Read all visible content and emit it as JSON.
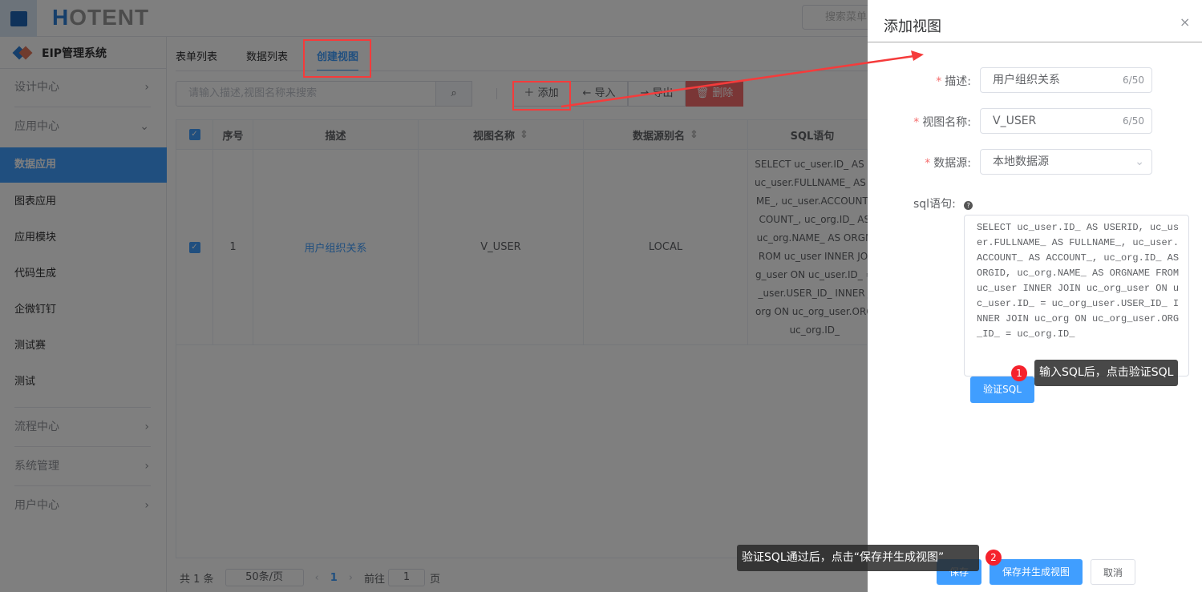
{
  "header": {
    "logo": "HOTENT",
    "search_placeholder": "搜索菜单"
  },
  "sidebar": {
    "brand": "EIP管理系统",
    "items": [
      {
        "label": "设计中心",
        "type": "group"
      },
      {
        "label": "应用中心",
        "type": "group"
      },
      {
        "label": "数据应用",
        "active": true
      },
      {
        "label": "图表应用"
      },
      {
        "label": "应用模块"
      },
      {
        "label": "代码生成"
      },
      {
        "label": "企微钉钉"
      },
      {
        "label": "测试赛"
      },
      {
        "label": "测试"
      },
      {
        "label": "流程中心",
        "type": "group"
      },
      {
        "label": "系统管理",
        "type": "group"
      },
      {
        "label": "用户中心",
        "type": "group"
      }
    ]
  },
  "tabs": [
    "表单列表",
    "数据列表",
    "创建视图"
  ],
  "toolbar": {
    "search_placeholder": "请输入描述,视图名称来搜索",
    "add": "添加",
    "import": "导入",
    "export": "导出",
    "delete": "删除"
  },
  "table": {
    "headers": [
      "序号",
      "描述",
      "视图名称",
      "数据源别名",
      "SQL语句"
    ],
    "rows": [
      {
        "index": "1",
        "desc": "用户组织关系",
        "name": "V_USER",
        "datasource": "LOCAL",
        "sql": "SELECT uc_user.ID_ AS U\nuc_user.FULLNAME_ AS F\nME_, uc_user.ACCOUNT_\nCOUNT_, uc_org.ID_ AS\nuc_org.NAME_ AS ORGN\nROM uc_user INNER JOI\ng_user ON uc_user.ID_ =\n_user.USER_ID_ INNER J\norg ON uc_org_user.ORG\nuc_org.ID_"
      }
    ]
  },
  "pager": {
    "total": "共 1 条",
    "size": "50条/页",
    "page": "1",
    "goto": "前往",
    "goto_value": "1",
    "page_unit": "页"
  },
  "drawer": {
    "title": "添加视图",
    "desc_label": "描述:",
    "desc_value": "用户组织关系",
    "desc_count": "6/50",
    "name_label": "视图名称:",
    "name_value": "V_USER",
    "name_count": "6/50",
    "ds_label": "数据源:",
    "ds_value": "本地数据源",
    "sql_label": "sql语句:",
    "sql_value": "SELECT uc_user.ID_ AS USERID, uc_us\ner.FULLNAME_ AS FULLNAME_, uc_user.\nACCOUNT_ AS ACCOUNT_, uc_org.ID_ AS\nORGID, uc_org.NAME_ AS ORGNAME FROM\nuc_user INNER JOIN uc_org_user ON u\nc_user.ID_ = uc_org_user.USER_ID_ I\nNNER JOIN uc_org ON uc_org_user.ORG\n_ID_ = uc_org.ID_",
    "verify": "验证SQL",
    "save": "保存",
    "save_gen": "保存并生成视图",
    "cancel": "取消"
  },
  "annotations": {
    "tip1_num": "1",
    "tip1": "输入SQL后，点击验证SQL",
    "tip2_num": "2",
    "tip2": "验证SQL通过后，点击“保存并生成视图”"
  },
  "colors": {
    "primary": "#409eff",
    "danger": "#f56c6c",
    "annotation": "#f53b3b"
  }
}
